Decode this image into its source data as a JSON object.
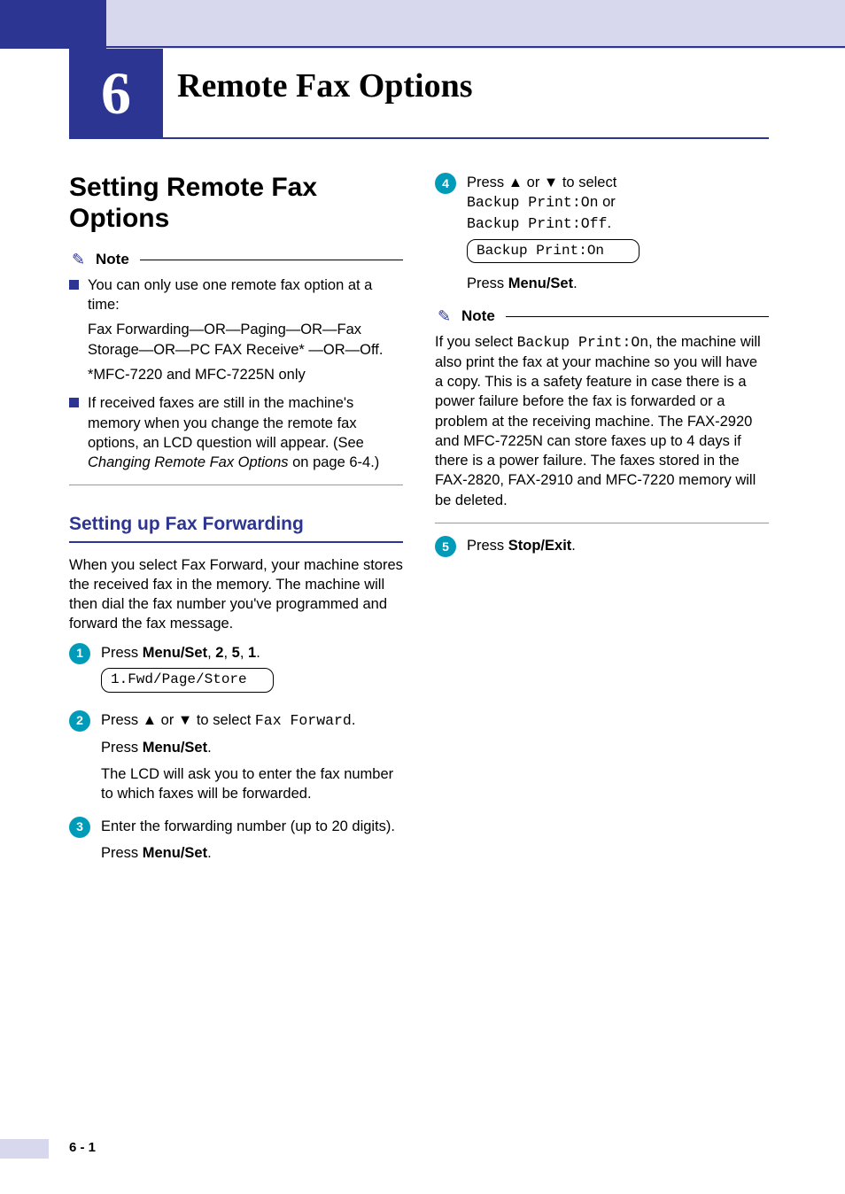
{
  "chapter": {
    "number": "6",
    "title": "Remote Fax Options"
  },
  "left": {
    "h1": "Setting Remote Fax Options",
    "note1": {
      "label": "Note",
      "bullet1_lines": {
        "a": "You can only use one remote fax option at a time:",
        "b": "Fax Forwarding—OR—Paging—OR—Fax Storage—OR—PC FAX Receive* —OR—Off.",
        "c": "*MFC-7220 and MFC-7225N only"
      },
      "bullet2": {
        "a": "If received faxes are still in the machine's memory when you change the remote fax options, an LCD question will appear. (See ",
        "b": "Changing Remote Fax Options",
        "c": " on page 6-4.)"
      }
    },
    "h2": "Setting up Fax Forwarding",
    "intro": "When you select Fax Forward, your machine stores the received fax in the memory. The machine will then dial the fax number you've programmed and forward the fax message.",
    "step1": {
      "a": "Press ",
      "b": "Menu/Set",
      "c": ", ",
      "d": "2",
      "e": ", ",
      "f": "5",
      "g": ", ",
      "h": "1",
      "i": ".",
      "lcd": "1.Fwd/Page/Store"
    },
    "step2": {
      "a": "Press ▲ or ▼ to select ",
      "b": "Fax Forward",
      "c": ".",
      "d": "Press ",
      "e": "Menu/Set",
      "f": ".",
      "g": "The LCD will ask you to enter the fax number to which faxes will be forwarded."
    },
    "step3": {
      "a": "Enter the forwarding number (up to 20 digits).",
      "b": "Press ",
      "c": "Menu/Set",
      "d": "."
    }
  },
  "right": {
    "step4": {
      "a": "Press ▲ or ▼ to select",
      "b": "Backup Print:On",
      "c": " or ",
      "d": "Backup Print:Off",
      "e": ".",
      "lcd": "Backup Print:On",
      "f": "Press ",
      "g": "Menu/Set",
      "h": "."
    },
    "note2": {
      "label": "Note",
      "a": "If you select ",
      "b": "Backup Print:On",
      "c": ", the machine will also print the fax at your machine so you will have a copy. This is a safety feature in case there is a power failure before the fax is forwarded or a problem at the receiving machine. The FAX-2920 and MFC-7225N can store faxes up to 4 days if there is a power failure. The faxes stored in the FAX-2820, FAX-2910 and MFC-7220 memory will be deleted."
    },
    "step5": {
      "a": "Press ",
      "b": "Stop/Exit",
      "c": "."
    }
  },
  "footer": "6 - 1"
}
